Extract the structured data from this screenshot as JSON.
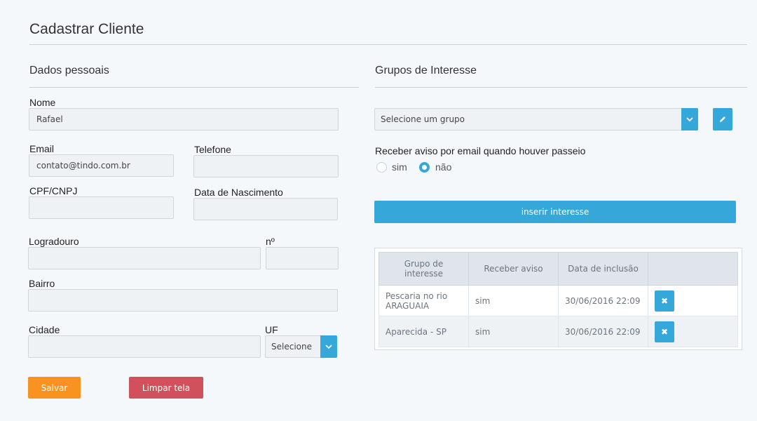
{
  "page": {
    "title": "Cadastrar Cliente"
  },
  "personal": {
    "section_title": "Dados pessoais",
    "nome": {
      "label": "Nome",
      "value": "Rafael"
    },
    "email": {
      "label": "Email",
      "value": "contato@tindo.com.br"
    },
    "telefone": {
      "label": "Telefone",
      "value": ""
    },
    "cpf": {
      "label": "CPF/CNPJ",
      "value": ""
    },
    "nascimento": {
      "label": "Data de Nascimento",
      "value": ""
    },
    "logradouro": {
      "label": "Logradouro",
      "value": ""
    },
    "numero": {
      "label": "nº",
      "value": ""
    },
    "bairro": {
      "label": "Bairro",
      "value": ""
    },
    "cidade": {
      "label": "Cidade",
      "value": ""
    },
    "uf": {
      "label": "UF",
      "selected": "Selecione"
    },
    "save_label": "Salvar",
    "clear_label": "Limpar tela"
  },
  "interests": {
    "section_title": "Grupos de Interesse",
    "group_select": "Selecione um grupo",
    "notify_question": "Receber aviso por email quando houver passeio",
    "opt_yes": "sim",
    "opt_no": "não",
    "selected_option": "não",
    "insert_label": "inserir interesse",
    "table": {
      "headers": [
        "Grupo de interesse",
        "Receber aviso",
        "Data de inclusão",
        ""
      ],
      "rows": [
        {
          "group": "Pescaria no rio ARAGUAIA",
          "notify": "sim",
          "date": "30/06/2016 22:09"
        },
        {
          "group": "Aparecida - SP",
          "notify": "sim",
          "date": "30/06/2016 22:09"
        }
      ]
    }
  },
  "colors": {
    "accent": "#35a7d8",
    "save": "#f7931e",
    "clear": "#d0505c"
  },
  "icons": {
    "caret": "chevron-down-icon",
    "edit": "pencil-icon",
    "delete": "close-icon"
  }
}
